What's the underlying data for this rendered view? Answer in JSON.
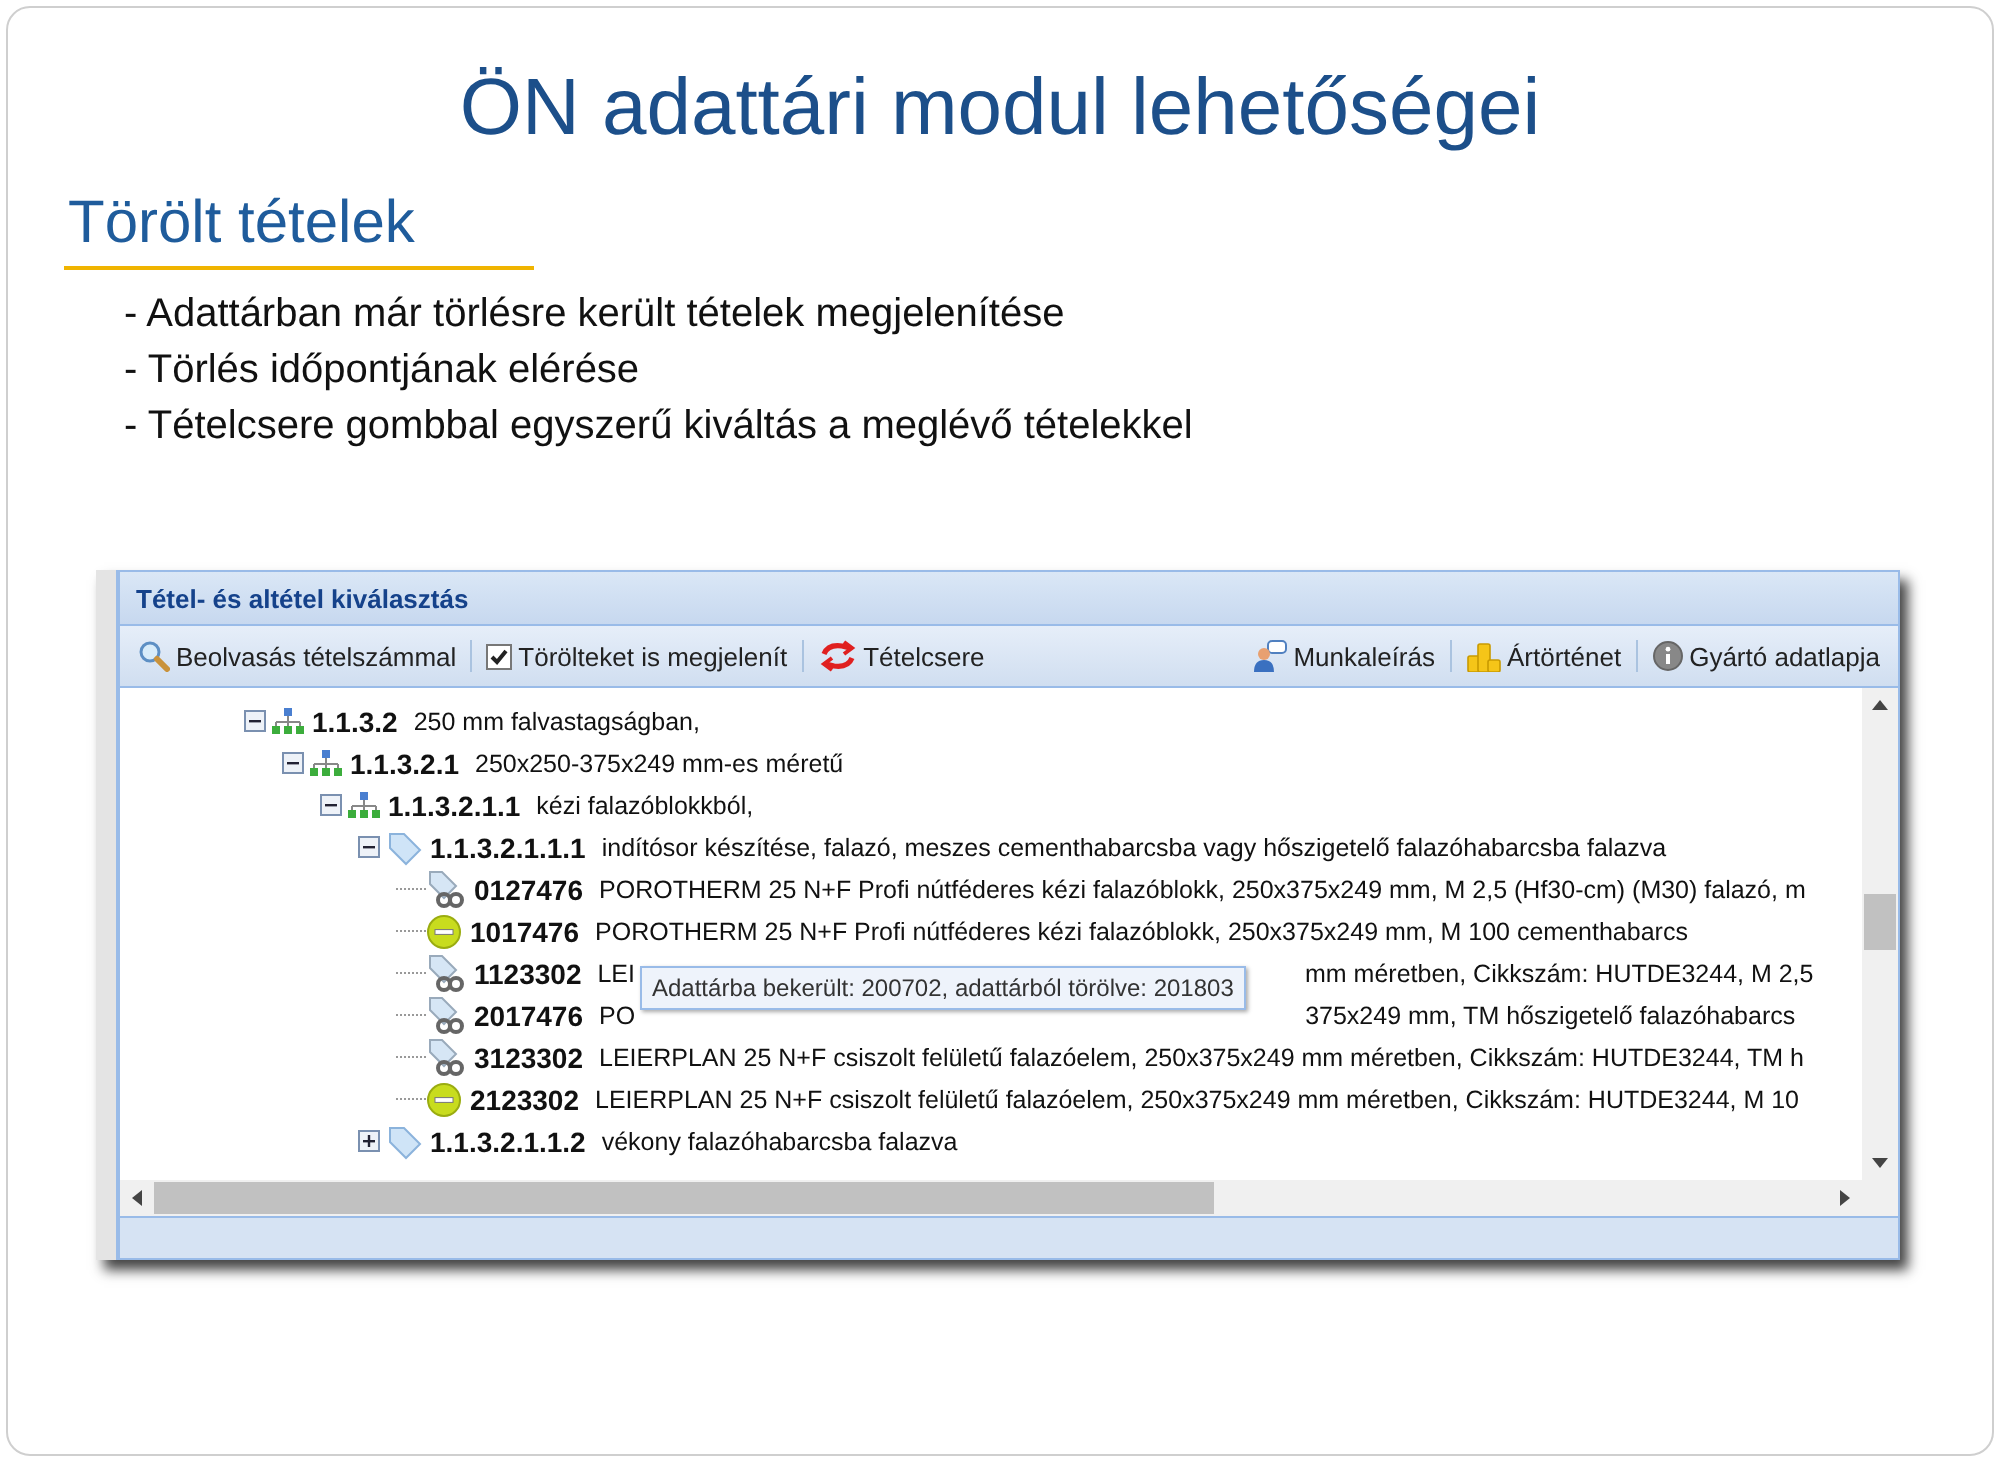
{
  "slide": {
    "title": "ÖN adattári modul lehetőségei",
    "subtitle": "Törölt tételek",
    "bullets": [
      "- Adattárban már törlésre került tételek megjelenítése",
      "- Törlés időpontjának elérése",
      "- Tételcsere gombbal egyszerű kiváltás a meglévő tételekkel"
    ]
  },
  "window": {
    "title": "Tétel- és altétel kiválasztás",
    "toolbar_left": [
      {
        "kind": "search",
        "label": "Beolvasás tételszámmal"
      },
      {
        "kind": "checkbox",
        "label": "Törölteket is megjelenít",
        "checked": true
      },
      {
        "kind": "swap",
        "label": "Tételcsere"
      }
    ],
    "toolbar_right": [
      {
        "kind": "worker",
        "label": "Munkaleírás"
      },
      {
        "kind": "coins",
        "label": "Ártörténet"
      },
      {
        "kind": "info",
        "label": "Gyártó adatlapja"
      }
    ],
    "tree": [
      {
        "kind": "group",
        "code": "1.1.3.2",
        "text": "250 mm falvastagságban,",
        "expanded": true,
        "children": [
          {
            "kind": "group",
            "code": "1.1.3.2.1",
            "text": "250x250-375x249 mm-es méretű",
            "expanded": true,
            "children": [
              {
                "kind": "group",
                "code": "1.1.3.2.1.1",
                "text": "kézi falazóblokkból,",
                "expanded": true,
                "children": [
                  {
                    "kind": "tag",
                    "code": "1.1.3.2.1.1.1",
                    "text": "indítósor készítése, falazó, meszes cementhabarcsba vagy hőszigetelő falazóhabarcsba falazva",
                    "expanded": true,
                    "children": [
                      {
                        "kind": "linked",
                        "code": "0127476",
                        "text": "POROTHERM 25 N+F Profi nútféderes kézi falazóblokk, 250x375x249 mm, M 2,5 (Hf30-cm) (M30) falazó, m"
                      },
                      {
                        "kind": "deleted",
                        "code": "1017476",
                        "text": "POROTHERM 25 N+F Profi nútféderes kézi falazóblokk, 250x375x249 mm, M 100 cementhabarcs"
                      },
                      {
                        "kind": "linked",
                        "code": "1123302",
                        "text": "LEI",
                        "text_after": "mm méretben, Cikkszám: HUTDE3244, M 2,5"
                      },
                      {
                        "kind": "linked",
                        "code": "2017476",
                        "text": "PO",
                        "text_after": "375x249 mm, TM hőszigetelő falazóhabarcs"
                      },
                      {
                        "kind": "linked",
                        "code": "3123302",
                        "text": "LEIERPLAN 25 N+F csiszolt felületű falazóelem, 250x375x249 mm méretben, Cikkszám: HUTDE3244, TM h"
                      },
                      {
                        "kind": "deleted",
                        "code": "2123302",
                        "text": "LEIERPLAN 25 N+F csiszolt felületű falazóelem, 250x375x249 mm méretben, Cikkszám: HUTDE3244, M 10"
                      }
                    ]
                  },
                  {
                    "kind": "tag",
                    "code": "1.1.3.2.1.1.2",
                    "text": "vékony falazóhabarcsba falazva",
                    "expanded": false
                  }
                ]
              }
            ]
          }
        ]
      }
    ],
    "tooltip": "Adattárba bekerült: 200702, adattárból törölve: 201803"
  }
}
